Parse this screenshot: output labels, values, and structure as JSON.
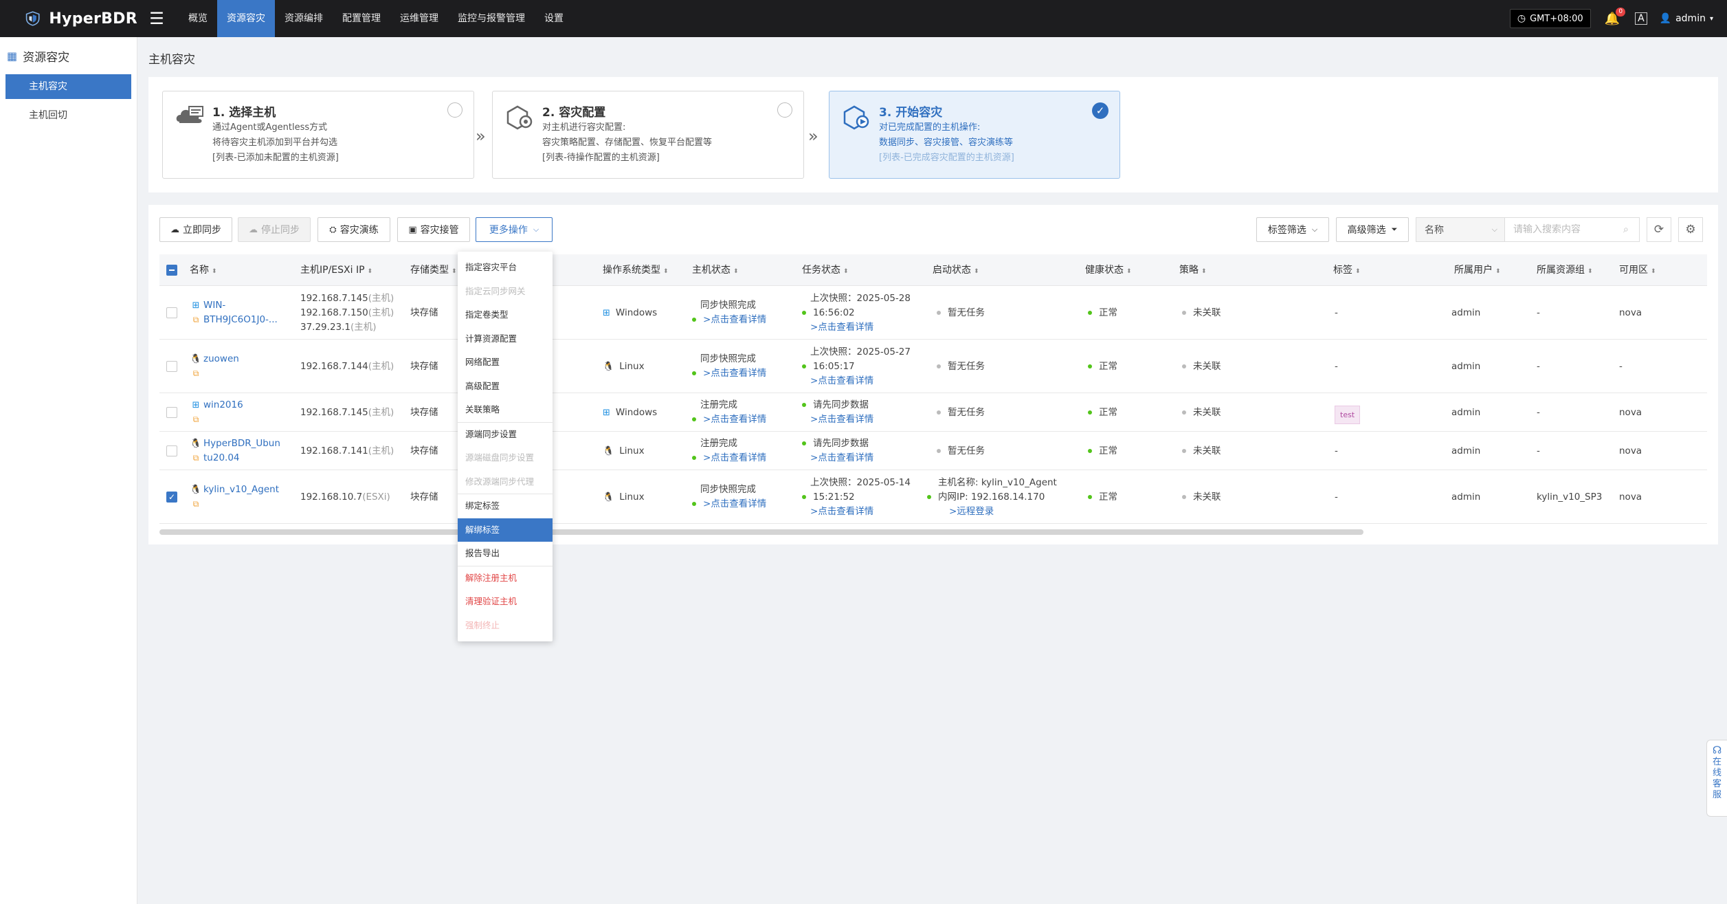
{
  "topbar": {
    "brand": "HyperBDR",
    "nav": [
      "概览",
      "资源容灾",
      "资源编排",
      "配置管理",
      "运维管理",
      "监控与报警管理",
      "设置"
    ],
    "active_nav": 1,
    "timezone": "GMT+08:00",
    "notification_count": "0",
    "font_toggle": "A",
    "user": "admin"
  },
  "sidebar": {
    "title": "资源容灾",
    "items": [
      "主机容灾",
      "主机回切"
    ],
    "active_item": 0
  },
  "page": {
    "title": "主机容灾"
  },
  "steps": [
    {
      "title": "1. 选择主机",
      "lines": [
        "通过Agent或Agentless方式",
        "将待容灾主机添加到平台并勾选",
        "[列表-已添加未配置的主机资源]"
      ],
      "state": "pending"
    },
    {
      "title": "2. 容灾配置",
      "lines": [
        "对主机进行容灾配置:",
        "容灾策略配置、存储配置、恢复平台配置等",
        "[列表-待操作配置的主机资源]"
      ],
      "state": "pending"
    },
    {
      "title": "3. 开始容灾",
      "lines": [
        "对已完成配置的主机操作:",
        "数据同步、容灾接管、容灾演练等",
        "[列表-已完成容灾配置的主机资源]"
      ],
      "state": "done"
    }
  ],
  "toolbar": {
    "sync_now": "立即同步",
    "stop_sync": "停止同步",
    "dr_drill": "容灾演练",
    "dr_takeover": "容灾接管",
    "more_ops": "更多操作",
    "tag_filter": "标签筛选",
    "advanced_filter": "高级筛选",
    "search_field": "名称",
    "search_placeholder": "请输入搜索内容"
  },
  "table": {
    "columns": [
      "名称",
      "主机IP/ESXi IP",
      "存储类型",
      "操作系统类型",
      "主机状态",
      "任务状态",
      "启动状态",
      "健康状态",
      "策略",
      "标签",
      "所属用户",
      "所属资源组",
      "可用区"
    ],
    "rows": [
      {
        "checked": false,
        "name_lines": [
          "WIN-",
          "BTH9JC6O1J0-..."
        ],
        "os_kind": "windows",
        "ip_lines": [
          {
            "ip": "192.168.7.145",
            "kind": "(主机)"
          },
          {
            "ip": "192.168.7.150",
            "kind": "(主机)"
          },
          {
            "ip": "37.29.23.1",
            "kind": "(主机)"
          }
        ],
        "storage": "块存储",
        "os": "Windows",
        "host_status": "同步快照完成",
        "host_status_link": ">点击查看详情",
        "task_status_lines": [
          "上次快照：2025-05-28",
          "16:56:02"
        ],
        "task_status_link": ">点击查看详情",
        "boot_status": [
          "暂无任务"
        ],
        "boot_link": "",
        "health": "正常",
        "policy": "未关联",
        "tag": "-",
        "user": "admin",
        "group": "-",
        "zone": "nova"
      },
      {
        "checked": false,
        "name_lines": [
          "zuowen"
        ],
        "os_kind": "linux",
        "ip_lines": [
          {
            "ip": "192.168.7.144",
            "kind": "(主机)"
          }
        ],
        "storage": "块存储",
        "os": "Linux",
        "host_status": "同步快照完成",
        "host_status_link": ">点击查看详情",
        "task_status_lines": [
          "上次快照：2025-05-27",
          "16:05:17"
        ],
        "task_status_link": ">点击查看详情",
        "boot_status": [
          "暂无任务"
        ],
        "boot_link": "",
        "health": "正常",
        "policy": "未关联",
        "tag": "-",
        "user": "admin",
        "group": "-",
        "zone": "-"
      },
      {
        "checked": false,
        "name_lines": [
          "win2016"
        ],
        "os_kind": "windows",
        "ip_lines": [
          {
            "ip": "192.168.7.145",
            "kind": "(主机)"
          }
        ],
        "storage": "块存储",
        "os": "Windows",
        "host_status": "注册完成",
        "host_status_link": ">点击查看详情",
        "task_status_lines": [
          "请先同步数据"
        ],
        "task_status_link": ">点击查看详情",
        "boot_status": [
          "暂无任务"
        ],
        "boot_link": "",
        "health": "正常",
        "policy": "未关联",
        "tag": "test",
        "user": "admin",
        "group": "-",
        "zone": "nova"
      },
      {
        "checked": false,
        "name_lines": [
          "HyperBDR_Ubun",
          "tu20.04"
        ],
        "os_kind": "linux",
        "ip_lines": [
          {
            "ip": "192.168.7.141",
            "kind": "(主机)"
          }
        ],
        "storage": "块存储",
        "os": "Linux",
        "host_status": "注册完成",
        "host_status_link": ">点击查看详情",
        "task_status_lines": [
          "请先同步数据"
        ],
        "task_status_link": ">点击查看详情",
        "boot_status": [
          "暂无任务"
        ],
        "boot_link": "",
        "health": "正常",
        "policy": "未关联",
        "tag": "-",
        "user": "admin",
        "group": "-",
        "zone": "nova"
      },
      {
        "checked": true,
        "name_lines": [
          "kylin_v10_Agent"
        ],
        "os_kind": "linux",
        "ip_lines": [
          {
            "ip": "192.168.10.7",
            "kind": "(ESXi)"
          }
        ],
        "storage": "块存储",
        "os": "Linux",
        "host_status": "同步快照完成",
        "host_status_link": ">点击查看详情",
        "task_status_lines": [
          "上次快照：2025-05-14",
          "15:21:52"
        ],
        "task_status_link": ">点击查看详情",
        "boot_status": [
          "主机名称: kylin_v10_Agent",
          "内网IP: 192.168.14.170"
        ],
        "boot_link": ">远程登录",
        "health": "正常",
        "policy": "未关联",
        "tag": "-",
        "user": "admin",
        "group": "kylin_v10_SP3",
        "zone": "nova"
      }
    ]
  },
  "more_menu": {
    "items": [
      {
        "label": "指定容灾平台",
        "state": "normal"
      },
      {
        "label": "指定云同步网关",
        "state": "disabled"
      },
      {
        "label": "指定卷类型",
        "state": "normal"
      },
      {
        "label": "计算资源配置",
        "state": "normal"
      },
      {
        "label": "网络配置",
        "state": "normal"
      },
      {
        "label": "高级配置",
        "state": "normal"
      },
      {
        "label": "关联策略",
        "state": "normal"
      },
      {
        "label": "源端同步设置",
        "state": "normal"
      },
      {
        "label": "源端磁盘同步设置",
        "state": "disabled"
      },
      {
        "label": "修改源端同步代理",
        "state": "disabled"
      },
      {
        "label": "绑定标签",
        "state": "normal"
      },
      {
        "label": "解绑标签",
        "state": "active"
      },
      {
        "label": "报告导出",
        "state": "normal"
      },
      {
        "label": "解除注册主机",
        "state": "danger"
      },
      {
        "label": "清理验证主机",
        "state": "danger"
      },
      {
        "label": "强制终止",
        "state": "danger-disabled"
      }
    ],
    "separators_after": [
      6,
      9,
      12
    ]
  },
  "service": {
    "label": "在线客服"
  }
}
